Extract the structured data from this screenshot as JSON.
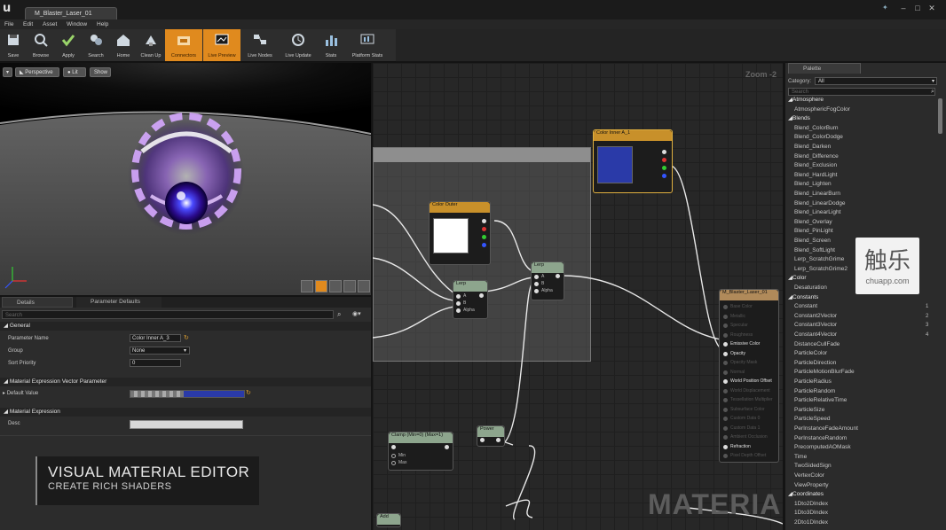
{
  "window": {
    "logo": "u",
    "doc_tab": "M_Blaster_Laser_01",
    "controls": [
      "–",
      "□",
      "✕"
    ]
  },
  "menu": [
    "File",
    "Edit",
    "Asset",
    "Window",
    "Help"
  ],
  "toolbar": [
    {
      "label": "Save",
      "icon": "save-icon",
      "active": false
    },
    {
      "label": "Browse",
      "icon": "browse-icon",
      "active": false
    },
    {
      "label": "Apply",
      "icon": "apply-icon",
      "active": false
    },
    {
      "label": "Search",
      "icon": "search-icon",
      "active": false
    },
    {
      "label": "Home",
      "icon": "home-icon",
      "active": false
    },
    {
      "label": "Clean Up",
      "icon": "clean-up-icon",
      "active": false
    },
    {
      "label": "Connectors",
      "icon": "connectors-icon",
      "active": true
    },
    {
      "label": "Live Preview",
      "icon": "live-preview-icon",
      "active": true
    },
    {
      "label": "Live Nodes",
      "icon": "live-nodes-icon",
      "active": false
    },
    {
      "label": "Live Update",
      "icon": "live-update-icon",
      "active": false
    },
    {
      "label": "Stats",
      "icon": "stats-icon",
      "active": false
    },
    {
      "label": "Platform Stats",
      "icon": "platform-stats-icon",
      "active": false
    }
  ],
  "viewport": {
    "perspective": "Perspective",
    "lit": "Lit",
    "show": "Show"
  },
  "details": {
    "tabs": [
      "Details",
      "Parameter Defaults"
    ],
    "search_placeholder": "Search",
    "general": {
      "title": "General",
      "parameter_name_label": "Parameter Name",
      "parameter_name_value": "Color Inner A_3",
      "group_label": "Group",
      "group_value": "None",
      "sort_priority_label": "Sort Priority",
      "sort_priority_value": "0"
    },
    "vector_param": {
      "title": "Material Expression Vector Parameter",
      "default_value_label": "Default Value"
    },
    "expression": {
      "title": "Material Expression",
      "desc_label": "Desc"
    }
  },
  "banner": {
    "title": "VISUAL MATERIAL EDITOR",
    "subtitle": "CREATE RICH SHADERS"
  },
  "graph": {
    "zoom": "Zoom -2",
    "watermark": "MATERIAL",
    "nodes": {
      "color_inner": {
        "title": "Color Inner A_1",
        "color": "#2a3aa8"
      },
      "color_outer": {
        "title": "Color Outer",
        "color": "#ffffff"
      },
      "lerp1": {
        "title": "Lerp",
        "pins": [
          "A",
          "B",
          "Alpha"
        ]
      },
      "lerp2": {
        "title": "Lerp",
        "pins": [
          "A",
          "B",
          "Alpha"
        ]
      },
      "clamp": {
        "title": "Clamp (Min=0) (Max=1)",
        "pins": [
          "Min",
          "Max"
        ]
      },
      "power": {
        "title": "Power"
      },
      "add": {
        "title": "Add"
      },
      "result": {
        "title": "M_Blaster_Laser_01",
        "pins": [
          "Base Color",
          "Metallic",
          "Specular",
          "Roughness",
          "Emissive Color",
          "Opacity",
          "Opacity Mask",
          "Normal",
          "World Position Offset",
          "World Displacement",
          "Tessellation Multiplier",
          "Subsurface Color",
          "Custom Data 0",
          "Custom Data 1",
          "Ambient Occlusion",
          "Refraction",
          "Pixel Depth Offset"
        ],
        "active": [
          4,
          5,
          8,
          15
        ]
      }
    }
  },
  "palette": {
    "tab": "Palette",
    "category_label": "Category:",
    "category_value": "All",
    "search_placeholder": "Search",
    "rows": [
      {
        "t": "c",
        "text": "Atmosphere"
      },
      {
        "t": "i",
        "text": "AtmosphericFogColor"
      },
      {
        "t": "c",
        "text": "Blends"
      },
      {
        "t": "i",
        "text": "Blend_ColorBurn"
      },
      {
        "t": "i",
        "text": "Blend_ColorDodge"
      },
      {
        "t": "i",
        "text": "Blend_Darken"
      },
      {
        "t": "i",
        "text": "Blend_Difference"
      },
      {
        "t": "i",
        "text": "Blend_Exclusion"
      },
      {
        "t": "i",
        "text": "Blend_HardLight"
      },
      {
        "t": "i",
        "text": "Blend_Lighten"
      },
      {
        "t": "i",
        "text": "Blend_LinearBurn"
      },
      {
        "t": "i",
        "text": "Blend_LinearDodge"
      },
      {
        "t": "i",
        "text": "Blend_LinearLight"
      },
      {
        "t": "i",
        "text": "Blend_Overlay"
      },
      {
        "t": "i",
        "text": "Blend_PinLight"
      },
      {
        "t": "i",
        "text": "Blend_Screen"
      },
      {
        "t": "i",
        "text": "Blend_SoftLight"
      },
      {
        "t": "i",
        "text": "Lerp_ScratchGrime"
      },
      {
        "t": "i",
        "text": "Lerp_ScratchGrime2"
      },
      {
        "t": "c",
        "text": "Color"
      },
      {
        "t": "i",
        "text": "Desaturation"
      },
      {
        "t": "c",
        "text": "Constants"
      },
      {
        "t": "i",
        "text": "Constant",
        "k": "1"
      },
      {
        "t": "i",
        "text": "Constant2Vector",
        "k": "2"
      },
      {
        "t": "i",
        "text": "Constant3Vector",
        "k": "3"
      },
      {
        "t": "i",
        "text": "Constant4Vector",
        "k": "4"
      },
      {
        "t": "i",
        "text": "DistanceCullFade"
      },
      {
        "t": "i",
        "text": "ParticleColor"
      },
      {
        "t": "i",
        "text": "ParticleDirection"
      },
      {
        "t": "i",
        "text": "ParticleMotionBlurFade"
      },
      {
        "t": "i",
        "text": "ParticleRadius"
      },
      {
        "t": "i",
        "text": "ParticleRandom"
      },
      {
        "t": "i",
        "text": "ParticleRelativeTime"
      },
      {
        "t": "i",
        "text": "ParticleSize"
      },
      {
        "t": "i",
        "text": "ParticleSpeed"
      },
      {
        "t": "i",
        "text": "PerInstanceFadeAmount"
      },
      {
        "t": "i",
        "text": "PerInstanceRandom"
      },
      {
        "t": "i",
        "text": "PrecomputedAOMask"
      },
      {
        "t": "i",
        "text": "Time"
      },
      {
        "t": "i",
        "text": "TwoSidedSign"
      },
      {
        "t": "i",
        "text": "VertexColor"
      },
      {
        "t": "i",
        "text": "ViewProperty"
      },
      {
        "t": "c",
        "text": "Coordinates"
      },
      {
        "t": "i",
        "text": "1Dto2DIndex"
      },
      {
        "t": "i",
        "text": "1Dto3DIndex"
      },
      {
        "t": "i",
        "text": "2Dto1DIndex"
      }
    ]
  },
  "corner_logo": {
    "glyph": "触乐",
    "domain": "chuapp.com"
  },
  "colors": {
    "accent": "#e08a1e",
    "node_header": "#c8902a",
    "inner_color": "#2a3aa8"
  }
}
